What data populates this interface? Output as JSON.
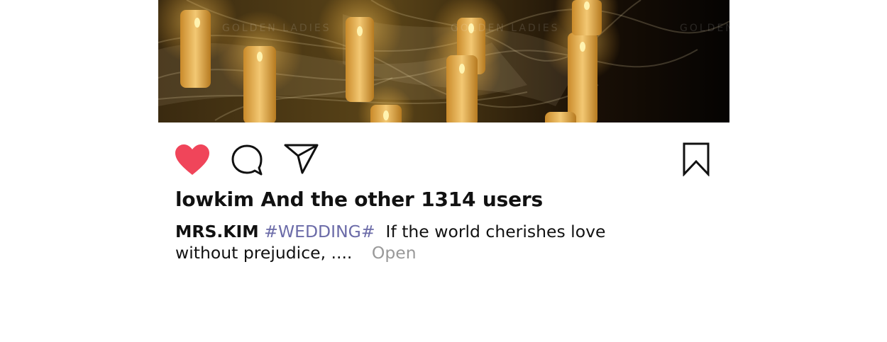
{
  "post": {
    "image": {
      "description_icon": "candles-photo",
      "watermark": "GOLDEN LADIES"
    },
    "actions": {
      "like_icon": "heart-icon",
      "like_color": "#f0455a",
      "comment_icon": "comment-icon",
      "share_icon": "paper-plane-icon",
      "save_icon": "bookmark-icon"
    },
    "likes_text": "lowkim And the other 1314 users",
    "caption": {
      "username": "MRS.KIM",
      "hashtag": "#WEDDING#",
      "text": "If the world cherishes love without prejudice, ....",
      "open_label": "Open",
      "hashtag_color": "#6b6ba8"
    }
  }
}
